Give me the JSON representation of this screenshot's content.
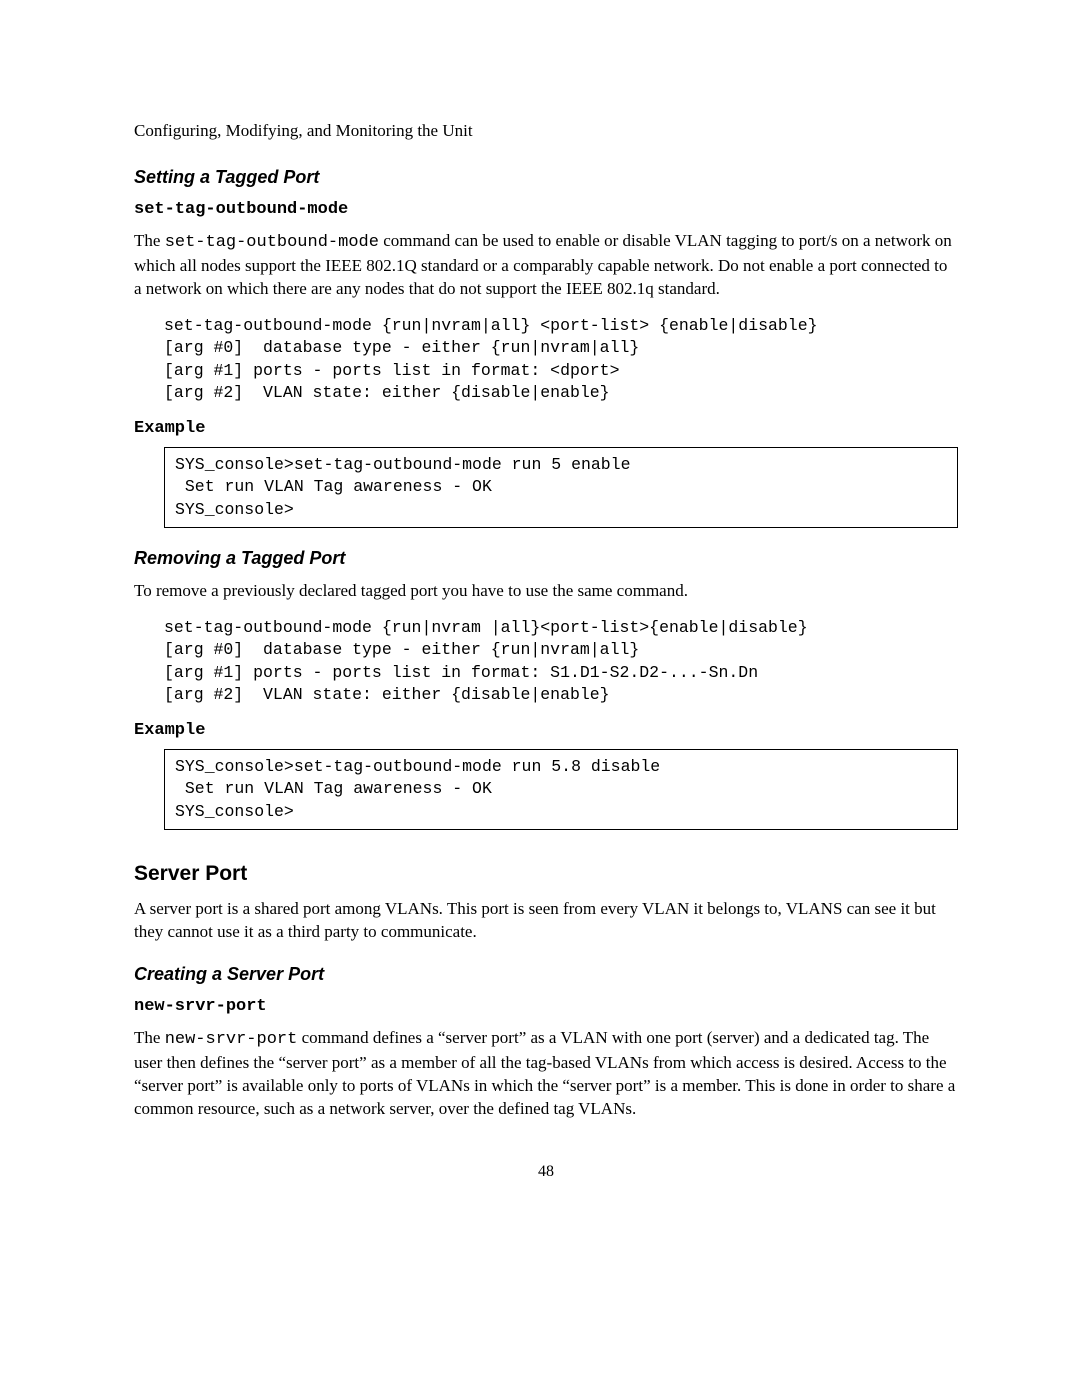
{
  "header": "Configuring, Modifying, and Monitoring the Unit",
  "s1": {
    "title": "Setting a Tagged Port",
    "cmd": "set-tag-outbound-mode",
    "para_pre": "The ",
    "para_cmd": "set-tag-outbound-mode",
    "para_post": " command can be used to enable or disable VLAN tagging to port/s on a network on which all nodes support the IEEE 802.1Q standard or a comparably capable network.  Do not enable a port connected to a network on which there are any nodes that do not support the IEEE 802.1q standard.",
    "code": "set-tag-outbound-mode {run|nvram|all} <port-list> {enable|disable}\n[arg #0]  database type - either {run|nvram|all}\n[arg #1] ports - ports list in format: <dport>\n[arg #2]  VLAN state: either {disable|enable}",
    "example_label": "Example",
    "example": "SYS_console>set-tag-outbound-mode run 5 enable\n Set run VLAN Tag awareness - OK\nSYS_console>"
  },
  "s2": {
    "title": "Removing a Tagged Port",
    "para": "To remove a previously declared tagged port you have to use the same command.",
    "code": "set-tag-outbound-mode {run|nvram |all}<port-list>{enable|disable}\n[arg #0]  database type - either {run|nvram|all}\n[arg #1] ports - ports list in format: S1.D1-S2.D2-...-Sn.Dn\n[arg #2]  VLAN state: either {disable|enable}",
    "example_label": "Example",
    "example": "SYS_console>set-tag-outbound-mode run 5.8 disable\n Set run VLAN Tag awareness - OK\nSYS_console>"
  },
  "s3": {
    "title": "Server Port",
    "para": "A server port is a shared port among VLANs.  This port is seen from every VLAN it belongs to, VLANS can see it but they cannot use it as a third party to communicate."
  },
  "s4": {
    "title": "Creating a Server Port",
    "cmd": "new-srvr-port",
    "para_pre": "The ",
    "para_cmd": "new-srvr-port",
    "para_post": " command defines a “server port” as a VLAN with one port (server) and a dedicated tag.  The user then defines the “server port” as a member of all the tag-based VLANs from which access is desired.  Access to the “server port” is available only to ports of VLANs in which the “server port” is a member.  This is done in order to share a common resource, such as a network server, over the defined tag VLANs."
  },
  "page_number": "48"
}
